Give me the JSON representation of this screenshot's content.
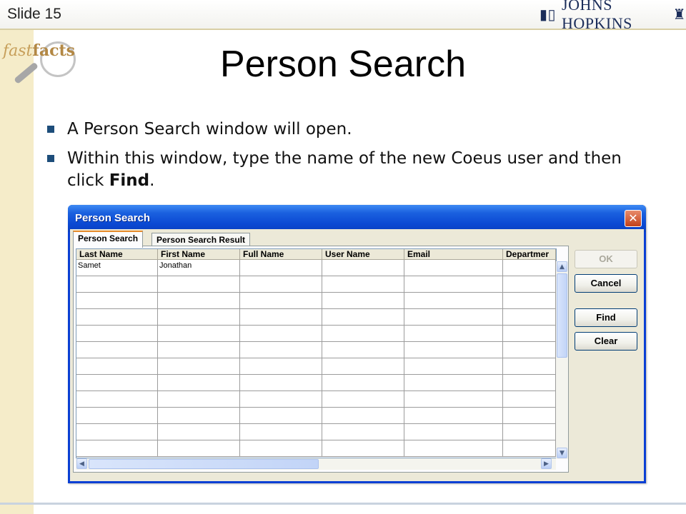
{
  "slide": {
    "number_label": "Slide 15",
    "logo_text": "JOHNS HOPKINS",
    "fastfacts_word1": "fast",
    "fastfacts_word2": "facts",
    "title": "Person Search",
    "bullets": [
      {
        "text": "A Person Search window will open."
      },
      {
        "text_before": "Within this window, type the name of the new Coeus user and then click ",
        "bold": "Find",
        "text_after": "."
      }
    ]
  },
  "window": {
    "title": "Person Search",
    "close_glyph": "✕",
    "tabs": [
      {
        "label": "Person Search",
        "active": true
      },
      {
        "label": "Person Search Result",
        "active": false
      }
    ],
    "grid": {
      "columns": [
        "Last Name",
        "First Name",
        "Full Name",
        "User Name",
        "Email",
        "Departmer"
      ],
      "rows": [
        [
          "Samet",
          "Jonathan",
          "",
          "",
          "",
          ""
        ],
        [
          "",
          "",
          "",
          "",
          "",
          ""
        ],
        [
          "",
          "",
          "",
          "",
          "",
          ""
        ],
        [
          "",
          "",
          "",
          "",
          "",
          ""
        ],
        [
          "",
          "",
          "",
          "",
          "",
          ""
        ],
        [
          "",
          "",
          "",
          "",
          "",
          ""
        ],
        [
          "",
          "",
          "",
          "",
          "",
          ""
        ],
        [
          "",
          "",
          "",
          "",
          "",
          ""
        ],
        [
          "",
          "",
          "",
          "",
          "",
          ""
        ],
        [
          "",
          "",
          "",
          "",
          "",
          ""
        ],
        [
          "",
          "",
          "",
          "",
          "",
          ""
        ],
        [
          "",
          "",
          "",
          "",
          "",
          ""
        ]
      ]
    },
    "buttons": {
      "ok": "OK",
      "cancel": "Cancel",
      "find": "Find",
      "clear": "Clear"
    },
    "colors": {
      "titlebar": "#0b49d3",
      "tab_highlight": "#e68b2c"
    }
  }
}
